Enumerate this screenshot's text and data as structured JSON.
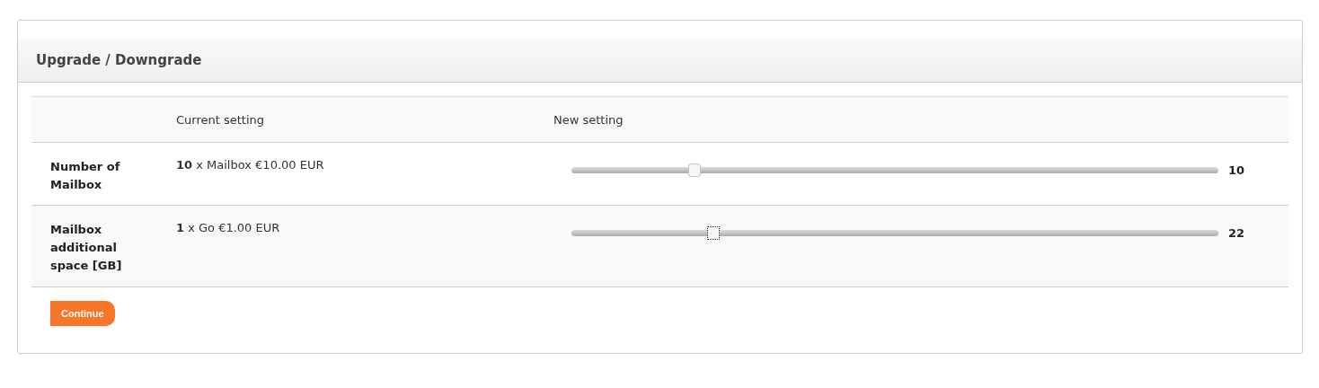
{
  "panel": {
    "title": "Upgrade / Downgrade"
  },
  "table": {
    "columns": [
      "Current setting",
      "New setting"
    ],
    "rows": [
      {
        "label": "Number of Mailbox",
        "quantity": "10",
        "current": "x Mailbox €10.00 EUR",
        "slider": {
          "level": 0.19,
          "focused": false
        },
        "reading": "10"
      },
      {
        "label": "Mailbox additional space [GB]",
        "quantity": "1",
        "current": "x Go €1.00 EUR",
        "slider": {
          "level": 0.22,
          "focused": true
        },
        "reading": "22"
      }
    ]
  },
  "buttons": [
    "Continue"
  ]
}
